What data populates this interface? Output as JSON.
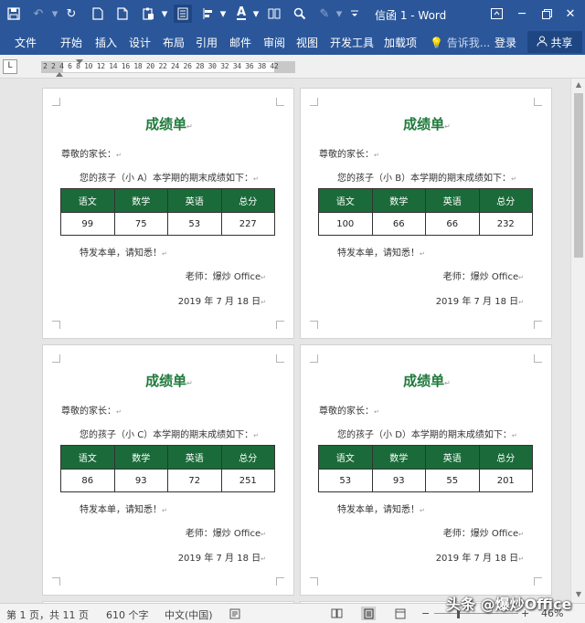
{
  "window": {
    "title": "信函 1 - Word",
    "quick_access": [
      "save-icon",
      "undo-icon",
      "redo-icon",
      "new-icon",
      "paste-icon",
      "layout-icon",
      "align-icon",
      "font-color-icon",
      "columns-icon",
      "find-icon",
      "highlight-icon",
      "customize-icon"
    ]
  },
  "ribbon": {
    "file_label": "文件",
    "tabs": [
      "开始",
      "插入",
      "设计",
      "布局",
      "引用",
      "邮件",
      "审阅",
      "视图",
      "开发工具",
      "加载项"
    ],
    "tell_me": "告诉我...",
    "login": "登录",
    "share": "共享"
  },
  "ruler": {
    "numbers": "2  2  4  6  8 10 12 14 16 18 20 22 24 26 28 30 32 34 36 38   42",
    "corner": "L"
  },
  "document": {
    "title": "成绩单",
    "greeting": "尊敬的家长：",
    "intro_prefix": "您的孩子（小 ",
    "intro_suffix": "）本学期的期末成绩如下：",
    "headers": [
      "语文",
      "数学",
      "英语",
      "总分"
    ],
    "notice": "特发本单，请知悉！",
    "teacher": "老师：爆炒 Office",
    "date": "2019 年 7 月 18 日",
    "cards": [
      {
        "student": "A",
        "scores": [
          "99",
          "75",
          "53",
          "227"
        ]
      },
      {
        "student": "B",
        "scores": [
          "100",
          "66",
          "66",
          "232"
        ]
      },
      {
        "student": "C",
        "scores": [
          "86",
          "93",
          "72",
          "251"
        ]
      },
      {
        "student": "D",
        "scores": [
          "53",
          "93",
          "55",
          "201"
        ]
      }
    ]
  },
  "status": {
    "page": "第 1 页，共 11 页",
    "words": "610 个字",
    "language": "中文(中国)",
    "zoom": "46%"
  },
  "watermark": "头条 @爆炒Office",
  "colors": {
    "ribbon": "#2b579a",
    "table_header": "#1b6b3a",
    "title": "#1f7a3c"
  }
}
